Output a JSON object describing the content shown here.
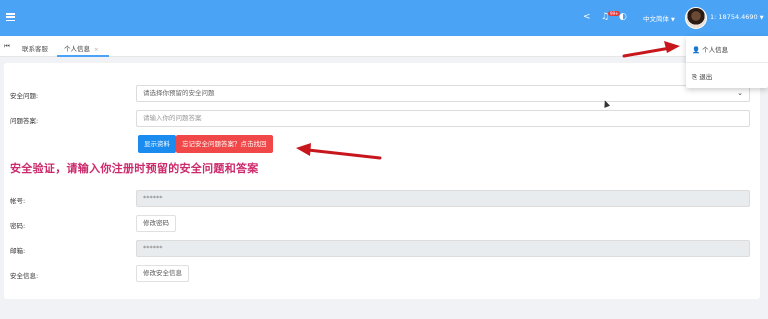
{
  "topbar": {
    "icons": [
      "menu-icon",
      "share-icon",
      "bell-icon",
      "palette-icon"
    ],
    "notification_badge": "99+",
    "language": "中文简体",
    "username": "18754.4690",
    "username_prefix": "1:"
  },
  "tabs": {
    "nav_icon": "⏮",
    "items": [
      {
        "label": "联系客服"
      },
      {
        "label": "个人信息",
        "close": "×"
      }
    ]
  },
  "dropdown": {
    "items": [
      {
        "label": "个人信息",
        "icon": "person-icon"
      },
      {
        "label": "退出",
        "icon": "logout-icon"
      }
    ]
  },
  "form": {
    "security_question_label": "安全问题:",
    "security_question_value": "请选择你预留的安全问题",
    "answer_label": "问题答案:",
    "answer_placeholder": "请输入你的问题答案",
    "show_button": "显示资料",
    "forgot_button": "忘记安全问题答案？点击找回",
    "verify_notice": "安全验证，请输入你注册时预留的安全问题和答案",
    "account_label": "帐号:",
    "account_value": "******",
    "password_label": "密码:",
    "password_button": "修改密码",
    "email_label": "邮箱:",
    "email_value": "******",
    "security_info_label": "安全信息:",
    "security_info_button": "修改安全信息"
  },
  "colors": {
    "topbar": "#4aa3f5",
    "accent_blue": "#1a8cf0",
    "danger_red": "#f04848",
    "notice_magenta": "#cc2a6c",
    "arrow_red": "#c8161d"
  }
}
